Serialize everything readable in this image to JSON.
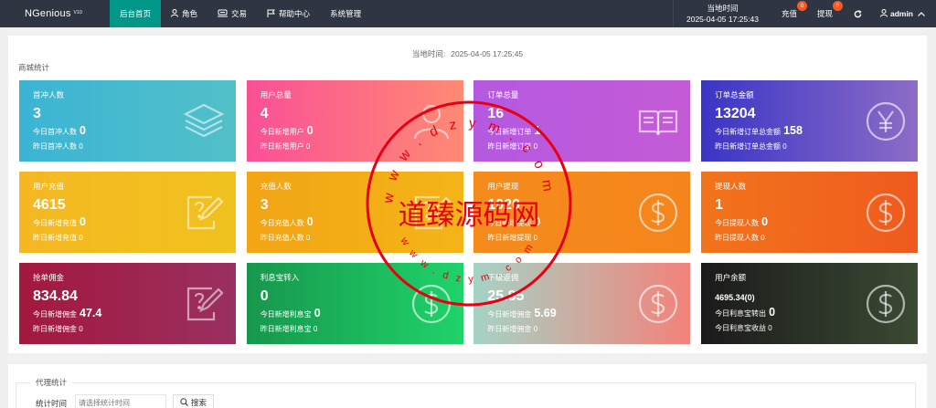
{
  "app": {
    "name": "NGenious",
    "version": "V10"
  },
  "nav": [
    {
      "label": "后台首页",
      "icon": "",
      "active": true
    },
    {
      "label": "角色",
      "icon": "user-icon"
    },
    {
      "label": "交易",
      "icon": "exchange-icon"
    },
    {
      "label": "帮助中心",
      "icon": "flag-icon"
    },
    {
      "label": "系统管理",
      "icon": ""
    }
  ],
  "header": {
    "clock_label": "当地时间",
    "clock_value": "2025-04-05 17:25:43",
    "recharge": {
      "label": "充值",
      "badge": "0"
    },
    "withdraw": {
      "label": "提现",
      "badge": "0"
    },
    "refresh_icon": "refresh-icon",
    "user": "admin"
  },
  "main": {
    "local_time_label": "当地时间:",
    "local_time_value": "2025-04-05 17:25:45",
    "section_title": "商城统计"
  },
  "cards": [
    {
      "title": "首冲人数",
      "value": "3",
      "line1_label": "今日首冲人数",
      "line1_value": "0",
      "line2": "昨日首冲人数 0",
      "icon": "layers-icon",
      "gradient": [
        "#3bb4d4",
        "#52c0c8"
      ]
    },
    {
      "title": "用户总量",
      "value": "4",
      "line1_label": "今日新增用户",
      "line1_value": "0",
      "line2": "昨日新增用户 0",
      "icon": "users-icon",
      "gradient": [
        "#fa5096",
        "#ff8a74"
      ]
    },
    {
      "title": "订单总量",
      "value": "16",
      "line1_label": "今日新增订单",
      "line1_value": "1",
      "line2": "昨日新增订单 0",
      "icon": "book-icon",
      "gradient": [
        "#b459e0",
        "#c45bd6"
      ]
    },
    {
      "title": "订单总金额",
      "value": "13204",
      "line1_label": "今日新增订单总金额",
      "line1_value": "158",
      "line2": "昨日新增订单总金额 0",
      "icon": "yen-icon",
      "gradient": [
        "#3a35c6",
        "#8c6cc6"
      ]
    },
    {
      "title": "用户充值",
      "value": "4615",
      "line1_label": "今日新增充值",
      "line1_value": "0",
      "line2": "昨日新增充值 0",
      "icon": "edit-icon",
      "gradient": [
        "#f5b822",
        "#f0c21e"
      ]
    },
    {
      "title": "充值人数",
      "value": "3",
      "line1_label": "今日充值人数",
      "line1_value": "0",
      "line2": "昨日充值人数 0",
      "icon": "edit-icon",
      "gradient": [
        "#f2a515",
        "#f4b418"
      ]
    },
    {
      "title": "用户提现",
      "value": "1020",
      "line1_label": "今日新增提现",
      "line1_value": "0",
      "line2": "昨日新增提现 0",
      "icon": "dollar-icon",
      "gradient": [
        "#f58b1c",
        "#f5851b"
      ]
    },
    {
      "title": "提现人数",
      "value": "1",
      "line1_label": "今日提现人数",
      "line1_value": "0",
      "line2": "昨日提现人数 0",
      "icon": "dollar-icon",
      "gradient": [
        "#f2741c",
        "#ef5a1e"
      ]
    },
    {
      "title": "抢单佣金",
      "value": "834.84",
      "line1_label": "今日新增佣金",
      "line1_value": "47.4",
      "line2": "昨日新增佣金 0",
      "icon": "edit-icon",
      "gradient": [
        "#a3183f",
        "#9a3060"
      ]
    },
    {
      "title": "利息宝转入",
      "value": "0",
      "line1_label": "今日新增利息宝",
      "line1_value": "0",
      "line2": "昨日新增利息宝 0",
      "icon": "dollar-icon",
      "gradient": [
        "#17974d",
        "#1fd36a"
      ]
    },
    {
      "title": "下级返佣",
      "value": "25.85",
      "line1_label": "今日新增佣金",
      "line1_value": "5.69",
      "line2": "昨日新增佣金 0",
      "icon": "dollar-icon",
      "gradient": [
        "#a5d3c5",
        "#f3827a"
      ]
    },
    {
      "title": "用户余额",
      "value": "4695.34(0)",
      "small": true,
      "line1_label": "今日利息宝转出",
      "line1_value": "0",
      "line2": "今日利息宝收益 0",
      "icon": "dollar-icon",
      "gradient": [
        "#1a1a1a",
        "#3b4a33"
      ]
    }
  ],
  "agent": {
    "legend": "代理统计",
    "filter_label": "统计时间",
    "filter_placeholder": "请选择统计时间",
    "search_label": "搜索"
  },
  "watermark": {
    "text": "道臻源码网",
    "ring_top": "www.dzym.com",
    "ring_bottom": "www.dzym.com",
    "color": "#e60012"
  }
}
